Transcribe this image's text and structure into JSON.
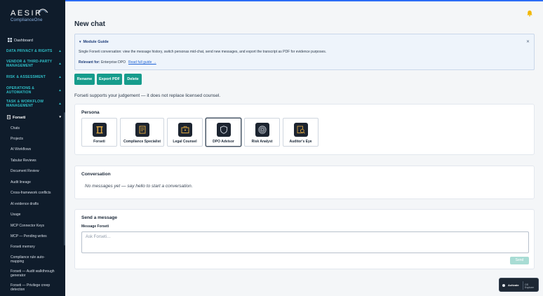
{
  "sidebar": {
    "logo_main": "AESIR",
    "logo_sub": "ComplianceOne",
    "dashboard": "Dashboard",
    "sections": [
      {
        "label": "DATA PRIVACY & RIGHTS",
        "lines": [
          "DATA PRIVACY & RIGHTS"
        ]
      },
      {
        "label": "VENDOR & THIRD-PARTY MANAGEMENT",
        "lines": [
          "VENDOR & THIRD-PARTY",
          "MANAGEMENT"
        ]
      },
      {
        "label": "RISK & ASSESSMENT",
        "lines": [
          "RISK & ASSESSMENT"
        ]
      },
      {
        "label": "OPERATIONS & AUTOMATION",
        "lines": [
          "OPERATIONS &",
          "AUTOMATION"
        ]
      },
      {
        "label": "TASK & WORKFLOW MANAGEMENT",
        "lines": [
          "TASK & WORKFLOW",
          "MANAGEMENT"
        ]
      }
    ],
    "forseti": "Forseti",
    "forseti_items": [
      {
        "label": "Chats"
      },
      {
        "label": "Projects"
      },
      {
        "label": "AI Workflows"
      },
      {
        "label": "Tabular Reviews"
      },
      {
        "label": "Document Review"
      },
      {
        "label": "Audit lineage"
      },
      {
        "label": "Cross-framework conflicts"
      },
      {
        "label": "AI evidence drafts"
      },
      {
        "label": "Usage"
      },
      {
        "label": "MCP Connector Keys"
      },
      {
        "label": "MCP — Pending writes"
      },
      {
        "label": "Forseti memory"
      },
      {
        "label": "Compliance rule auto-mapping",
        "lines": [
          "Compliance rule auto-",
          "mapping"
        ]
      },
      {
        "label": "Forseti — Audit walkthrough generator",
        "lines": [
          "Forseti — Audit walkthrough",
          "generator"
        ]
      },
      {
        "label": "Forseti — Privilege creep detection",
        "lines": [
          "Forseti — Privilege creep",
          "detection"
        ]
      }
    ]
  },
  "header": {
    "title": "New chat"
  },
  "guide": {
    "title": "Module Guide",
    "description": "Single Forseti conversation: view the message history, switch personas mid-chat, send new messages, and export the transcript as PDF for evidence purposes.",
    "relevant_label": "Relevant for:",
    "relevant_value": "Enterprise DPO",
    "link": "Read full guide →"
  },
  "actions": {
    "rename": "Rename",
    "export": "Export PDF",
    "delete": "Delete"
  },
  "disclaimer": "Forseti supports your judgement — it does not replace licensed counsel.",
  "persona": {
    "title": "Persona",
    "items": [
      {
        "label": "Forseti",
        "icon": "pillar-icon"
      },
      {
        "label": "Compliance Specialist",
        "icon": "document-icon"
      },
      {
        "label": "Legal Counsel",
        "icon": "briefcase-icon"
      },
      {
        "label": "DPO Advisor",
        "icon": "shield-icon"
      },
      {
        "label": "Risk Analyst",
        "icon": "target-icon"
      },
      {
        "label": "Auditor's Eye",
        "icon": "magnifier-icon"
      }
    ],
    "selected": "DPO Advisor"
  },
  "conversation": {
    "title": "Conversation",
    "empty": "No messages yet — say hello to start a conversation."
  },
  "send": {
    "title": "Send a message",
    "label": "Message Forseti",
    "placeholder": "Ask Forseti…",
    "button": "Send"
  },
  "widget": {
    "label": "Activate",
    "sub": "OS Explorer"
  },
  "colors": {
    "accent": "#169c8c",
    "sidebar": "#0f1c2b",
    "section": "#2fc0c9",
    "link": "#1e63d6"
  }
}
